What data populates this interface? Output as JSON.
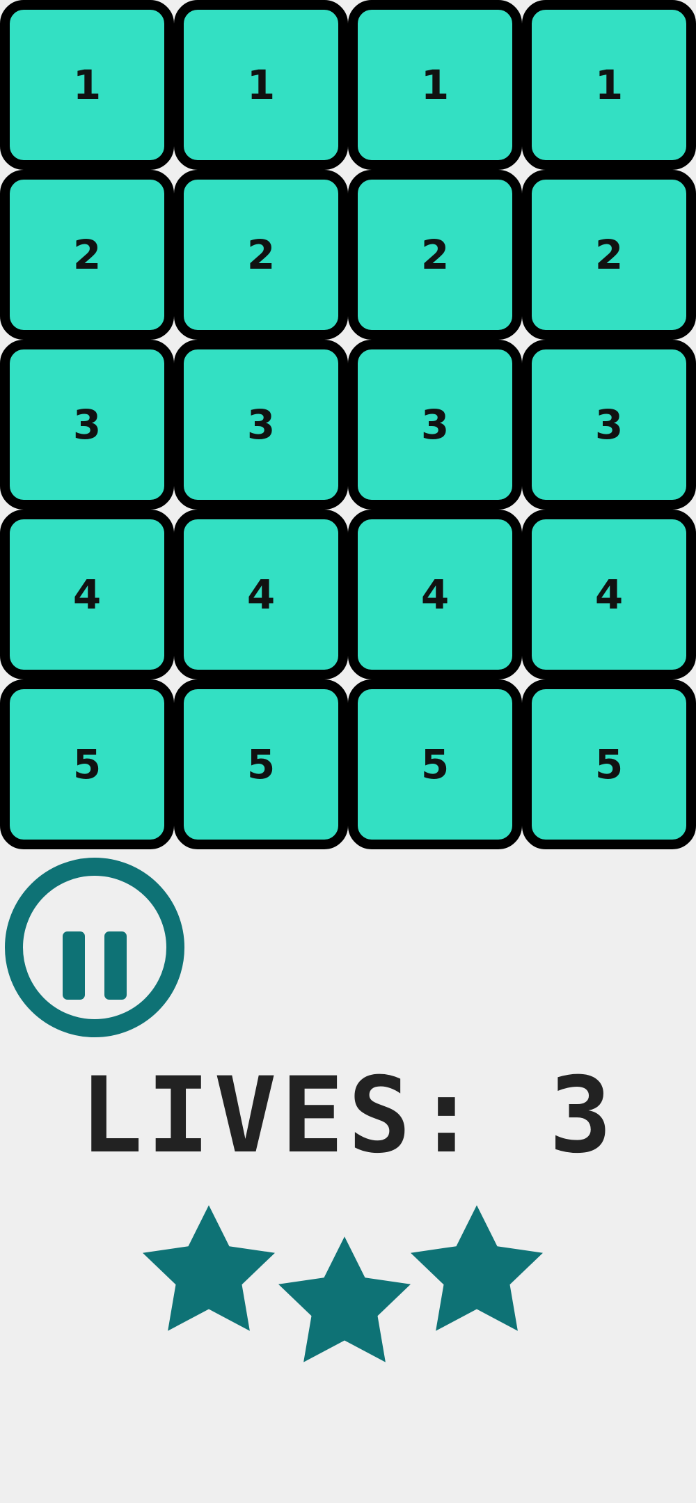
{
  "colors": {
    "background": "#efefef",
    "tile_fill": "#33e0c3",
    "tile_border": "#000000",
    "accent": "#0e7275",
    "text": "#222222"
  },
  "grid": {
    "columns": 4,
    "rows": [
      {
        "tiles": [
          "1",
          "1",
          "1",
          "1"
        ]
      },
      {
        "tiles": [
          "2",
          "2",
          "2",
          "2"
        ]
      },
      {
        "tiles": [
          "3",
          "3",
          "3",
          "3"
        ]
      },
      {
        "tiles": [
          "4",
          "4",
          "4",
          "4"
        ]
      },
      {
        "tiles": [
          "5",
          "5",
          "5",
          "5"
        ]
      }
    ]
  },
  "pause": {
    "icon": "pause-icon"
  },
  "lives": {
    "text": "LIVES: 3"
  },
  "stars": {
    "icon": "star-icon",
    "count": 3
  }
}
